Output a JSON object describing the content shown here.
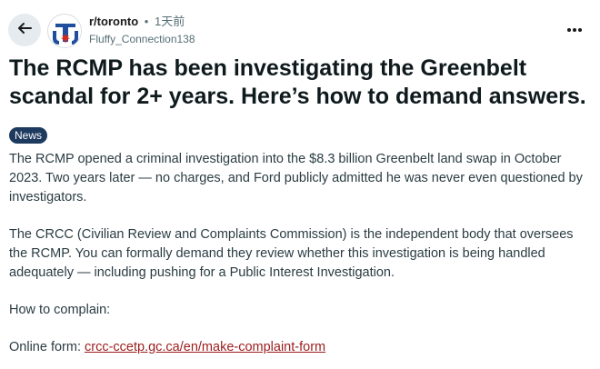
{
  "header": {
    "back_icon": "arrow-left-icon",
    "subreddit": "r/toronto",
    "separator": "•",
    "age": "1天前",
    "author": "Fluffy_Connection138",
    "more_label": "•••"
  },
  "post": {
    "title": "The RCMP has been investigating the Greenbelt scandal for 2+ years. Here’s how to demand answers.",
    "flair": "News",
    "paragraphs": [
      "The RCMP opened a criminal investigation into the $8.3 billion Greenbelt land swap in October 2023. Two years later — no charges, and Ford publicly admitted he was never even questioned by investigators.",
      "The CRCC (Civilian Review and Complaints Commission) is the independent body that oversees the RCMP. You can formally demand they review whether this investigation is being handled adequately — including pushing for a Public Interest Investigation.",
      "How to complain:"
    ],
    "online_form_label": "Online form: ",
    "online_form_link": "crcc-ccetp.gc.ca/en/make-complaint-form"
  },
  "colors": {
    "flair_bg": "#1e3a5f",
    "link": "#9c1c1c",
    "back_button_bg": "#e5ebee",
    "avatar_blue": "#1f4e9c",
    "maple_red": "#d52b1e"
  }
}
